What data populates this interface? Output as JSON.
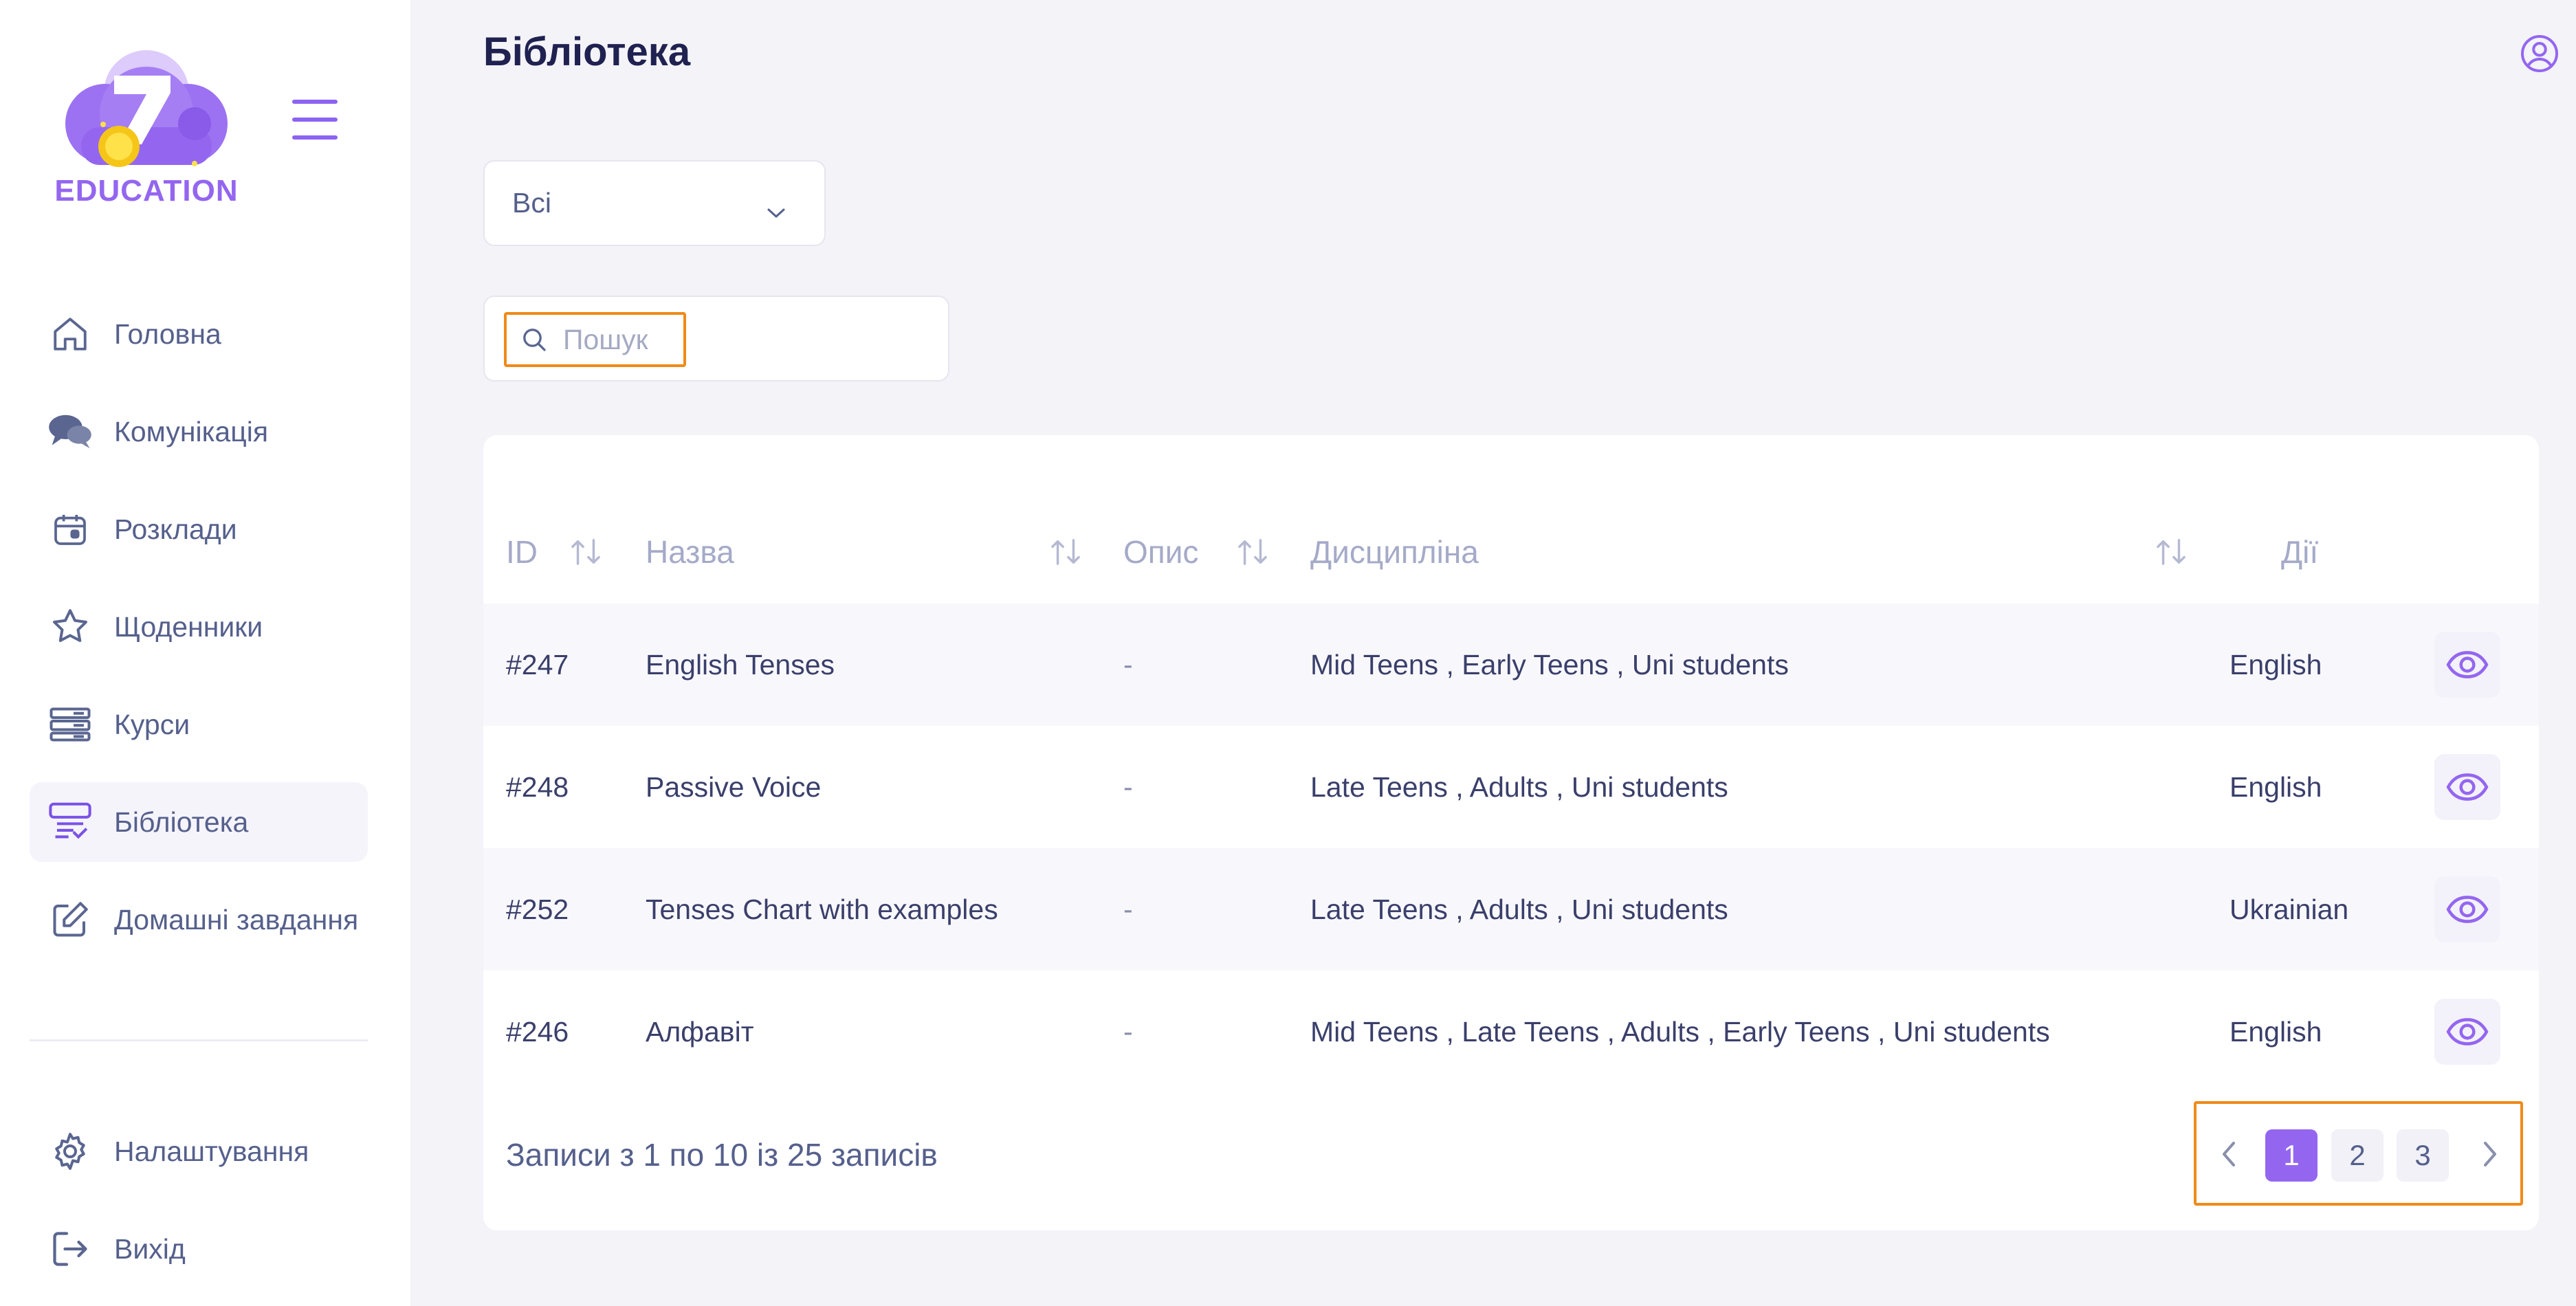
{
  "brand": {
    "logo_text": "EDUCATION",
    "accent": "#9466f0",
    "highlight": "#f08a18"
  },
  "sidebar": {
    "items": [
      {
        "label": "Головна",
        "icon": "home-icon"
      },
      {
        "label": "Комунікація",
        "icon": "chat-bubbles-icon"
      },
      {
        "label": "Розклади",
        "icon": "calendar-icon"
      },
      {
        "label": "Щоденники",
        "icon": "star-icon"
      },
      {
        "label": "Курси",
        "icon": "server-stack-icon"
      },
      {
        "label": "Бібліотека",
        "icon": "library-icon",
        "active": true
      },
      {
        "label": "Домашні завдання",
        "icon": "edit-icon"
      }
    ],
    "bottom_items": [
      {
        "label": "Налаштування",
        "icon": "gear-icon"
      },
      {
        "label": "Вихід",
        "icon": "logout-icon"
      }
    ]
  },
  "header": {
    "title": "Бібліотека",
    "user_icon": "user-circle-icon"
  },
  "filter": {
    "selected": "Всі"
  },
  "search": {
    "placeholder": "Пошук"
  },
  "table": {
    "columns": [
      "ID",
      "Назва",
      "Опис",
      "Дисципліна",
      "Дії"
    ],
    "rows": [
      {
        "id": "#247",
        "name": "English Tenses",
        "description": "-",
        "discipline": "Mid Teens , Early Teens , Uni students",
        "language": "English"
      },
      {
        "id": "#248",
        "name": "Passive Voice",
        "description": "-",
        "discipline": "Late Teens , Adults , Uni students",
        "language": "English"
      },
      {
        "id": "#252",
        "name": "Tenses Chart with examples",
        "description": "-",
        "discipline": "Late Teens , Adults , Uni students",
        "language": "Ukrainian"
      },
      {
        "id": "#246",
        "name": "Алфавіт",
        "description": "-",
        "discipline": "Mid Teens , Late Teens , Adults , Early Teens , Uni students",
        "language": "English"
      }
    ]
  },
  "pagination": {
    "info": "Записи з 1 по 10 із 25 записів",
    "pages": [
      "1",
      "2",
      "3"
    ],
    "current": "1"
  }
}
